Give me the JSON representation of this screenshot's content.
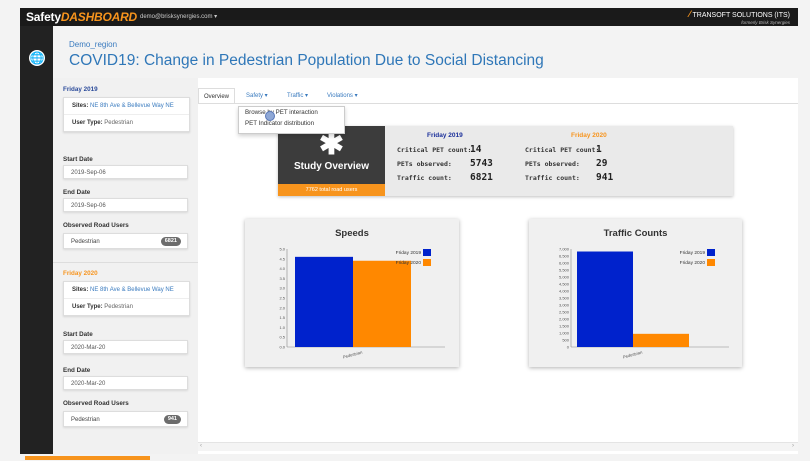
{
  "app": {
    "brand_prefix": "Safety",
    "brand_suffix": "DASHBOARD",
    "user_menu": "demo@brisksynergies.com ▾",
    "company": "TRANSOFT SOLUTIONS (ITS)",
    "company_sub": "formerly Brisk Synergies"
  },
  "header": {
    "region": "Demo_region",
    "title": "COVID19: Change in Pedestrian Population Due to Social Distancing"
  },
  "sidebar": {
    "period1": {
      "title": "Friday 2019",
      "sites_label": "Sites:",
      "sites_value": "NE 8th Ave & Bellevue Way NE",
      "user_type_label": "User Type:",
      "user_type_value": "Pedestrian",
      "start_label": "Start Date",
      "start_value": "2019-Sep-06",
      "end_label": "End Date",
      "end_value": "2019-Sep-06",
      "observed_label": "Observed Road Users",
      "observed_name": "Pedestrian",
      "observed_count": "6821"
    },
    "period2": {
      "title": "Friday 2020",
      "sites_label": "Sites:",
      "sites_value": "NE 8th Ave & Bellevue Way NE",
      "user_type_label": "User Type:",
      "user_type_value": "Pedestrian",
      "start_label": "Start Date",
      "start_value": "2020-Mar-20",
      "end_label": "End Date",
      "end_value": "2020-Mar-20",
      "observed_label": "Observed Road Users",
      "observed_name": "Pedestrian",
      "observed_count": "941"
    }
  },
  "tabs": {
    "overview": "Overview",
    "safety": "Safety ▾",
    "traffic": "Traffic ▾",
    "violations": "Violations ▾"
  },
  "dropdown": {
    "items": [
      "Browse by PET interaction",
      "PET Indicator distribution"
    ]
  },
  "study": {
    "label": "Study Overview",
    "total": "7762 total road users",
    "col1_title": "Friday 2019",
    "col2_title": "Friday 2020",
    "labels": [
      "Critical PET count:",
      "PETs observed:",
      "Traffic count:"
    ],
    "col1_values": [
      "14",
      "5743",
      "6821"
    ],
    "col2_values": [
      "1",
      "29",
      "941"
    ],
    "colors": {
      "col1": "#1a2f9a",
      "col2": "#f7941d"
    }
  },
  "chart_data": [
    {
      "type": "bar",
      "title": "Speeds",
      "categories": [
        "Pedestrian"
      ],
      "series": [
        {
          "name": "Friday 2019",
          "values": [
            4.6
          ],
          "color": "#0022cc"
        },
        {
          "name": "Friday 2020",
          "values": [
            4.4
          ],
          "color": "#ff8800"
        }
      ],
      "ylim": [
        0,
        5.0
      ],
      "yticks": [
        "0.0",
        "0.5",
        "1.0",
        "1.5",
        "2.0",
        "2.5",
        "3.0",
        "3.5",
        "4.0",
        "4.5",
        "5.0"
      ],
      "legend": "top-right"
    },
    {
      "type": "bar",
      "title": "Traffic Counts",
      "categories": [
        "Pedestrian"
      ],
      "series": [
        {
          "name": "Friday 2019",
          "values": [
            6821
          ],
          "color": "#0022cc"
        },
        {
          "name": "Friday 2020",
          "values": [
            941
          ],
          "color": "#ff8800"
        }
      ],
      "ylim": [
        0,
        7000
      ],
      "yticks": [
        "0",
        "500",
        "1,000",
        "1,500",
        "2,000",
        "2,500",
        "3,000",
        "3,500",
        "4,000",
        "4,500",
        "5,000",
        "5,500",
        "6,000",
        "6,500",
        "7,000"
      ],
      "legend": "top-right"
    }
  ]
}
